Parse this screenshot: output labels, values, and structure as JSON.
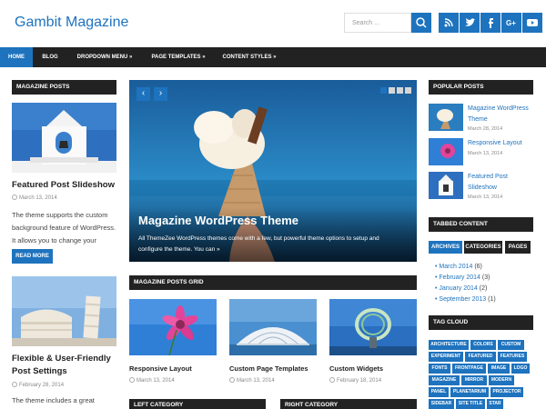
{
  "header": {
    "site_title": "Gambit Magazine",
    "search_placeholder": "Search ...",
    "social_icons": [
      "rss-icon",
      "twitter-icon",
      "facebook-icon",
      "google-plus-icon",
      "youtube-icon"
    ]
  },
  "nav": {
    "items": [
      "HOME",
      "BLOG",
      "DROPDOWN MENU »",
      "PAGE TEMPLATES »",
      "CONTENT STYLES »"
    ]
  },
  "left": {
    "widget_title": "MAGAZINE POSTS",
    "post1": {
      "title": "Featured Post Slideshow",
      "date": "March 13, 2014",
      "excerpt": [
        "The theme supports the custom",
        "background feature of WordPress.",
        "It allows you to change your"
      ],
      "read_more": "READ MORE"
    },
    "post2": {
      "title_lines": [
        "Flexible & User-Friendly",
        "Post Settings"
      ],
      "date": "February 28, 2014",
      "excerpt": [
        "The theme includes a great"
      ]
    }
  },
  "slider": {
    "title": "Magazine WordPress Theme",
    "excerpt_lines": [
      "All ThemeZee WordPress themes come with a few, but powerful theme options to setup and",
      "configure the theme. You can »"
    ],
    "prev": "‹",
    "next": "›"
  },
  "grid": {
    "widget_title": "MAGAZINE POSTS GRID",
    "posts": [
      {
        "title": "Responsive Layout",
        "date": "March 13, 2014"
      },
      {
        "title": "Custom Page Templates",
        "date": "March 13, 2014"
      },
      {
        "title": "Custom Widgets",
        "date": "February 18, 2014"
      }
    ]
  },
  "bottom": {
    "left_title": "LEFT CATEGORY",
    "right_title": "RIGHT CATEGORY"
  },
  "right": {
    "popular_title": "POPULAR POSTS",
    "popular": [
      {
        "title_lines": [
          "Magazine WordPress",
          "Theme"
        ],
        "date": "March 28, 2014"
      },
      {
        "title_lines": [
          "Responsive Layout"
        ],
        "date": "March 13, 2014"
      },
      {
        "title_lines": [
          "Featured Post",
          "Slideshow"
        ],
        "date": "March 13, 2014"
      }
    ],
    "tabbed_title": "TABBED CONTENT",
    "tabs": [
      "ARCHIVES",
      "CATEGORIES",
      "PAGES"
    ],
    "archives": [
      {
        "label": "March 2014",
        "count": "(6)"
      },
      {
        "label": "February 2014",
        "count": "(3)"
      },
      {
        "label": "January 2014",
        "count": "(2)"
      },
      {
        "label": "September 2013",
        "count": "(1)"
      }
    ],
    "tag_title": "TAG CLOUD",
    "tags": [
      "ARCHITECTURE",
      "COLORS",
      "CUSTOM",
      "EXPERIMENT",
      "FEATURED",
      "FEATURES",
      "FONTS",
      "FRONTPAGE",
      "IMAGE",
      "LOGO",
      "MAGAZINE",
      "MIRROR",
      "MODERN",
      "PANEL",
      "PLANETARIUM",
      "PROJECTOR",
      "SIDEBAR",
      "SITE TITLE",
      "STAR"
    ]
  },
  "colors": {
    "accent": "#1e73be",
    "dark": "#222222"
  }
}
